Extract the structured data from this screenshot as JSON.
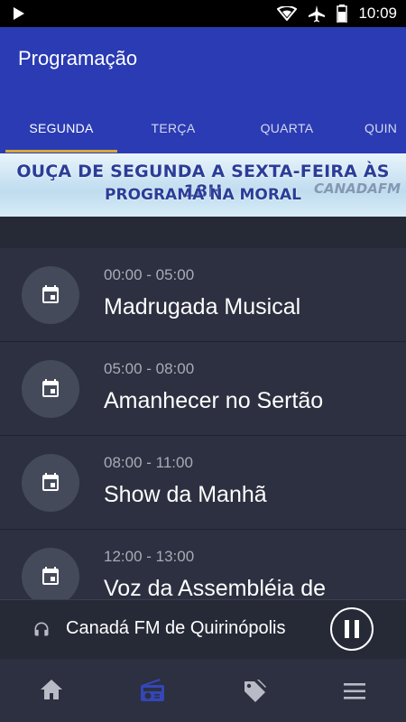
{
  "status_bar": {
    "time": "10:09",
    "icons": [
      "play-icon",
      "wifi-icon",
      "airplane-icon",
      "battery-icon"
    ]
  },
  "app_bar": {
    "title": "Programação",
    "tabs": [
      {
        "label": "SEGUNDA",
        "active": true
      },
      {
        "label": "TERÇA",
        "active": false
      },
      {
        "label": "QUARTA",
        "active": false
      },
      {
        "label": "QUIN",
        "active": false
      }
    ],
    "accent_color": "#d7a83c",
    "bar_color": "#2a3bb3"
  },
  "banner": {
    "line1": "OUÇA DE SEGUNDA A SEXTA-FEIRA ÀS 18H",
    "line2": "PROGRAMA NA MORAL",
    "logo_text": "CANADAFM"
  },
  "schedule": [
    {
      "time": "00:00 - 05:00",
      "name": "Madrugada Musical",
      "icon": "calendar-icon"
    },
    {
      "time": "05:00 - 08:00",
      "name": "Amanhecer no Sertão",
      "icon": "calendar-icon"
    },
    {
      "time": "08:00 - 11:00",
      "name": "Show da Manhã",
      "icon": "calendar-icon"
    },
    {
      "time": "12:00 - 13:00",
      "name": "Voz da Assembléia de",
      "icon": "calendar-icon"
    }
  ],
  "player": {
    "station": "Canadá FM de Quirinópolis",
    "state": "playing"
  },
  "bottom_nav": [
    {
      "name": "home",
      "icon": "home-icon",
      "active": false
    },
    {
      "name": "radio",
      "icon": "radio-icon",
      "active": true
    },
    {
      "name": "tags",
      "icon": "tag-icon",
      "active": false
    },
    {
      "name": "menu",
      "icon": "menu-icon",
      "active": false
    }
  ],
  "colors": {
    "active_nav": "#3446b8",
    "inactive_nav": "#b8bbc5",
    "background": "#2c3040"
  }
}
